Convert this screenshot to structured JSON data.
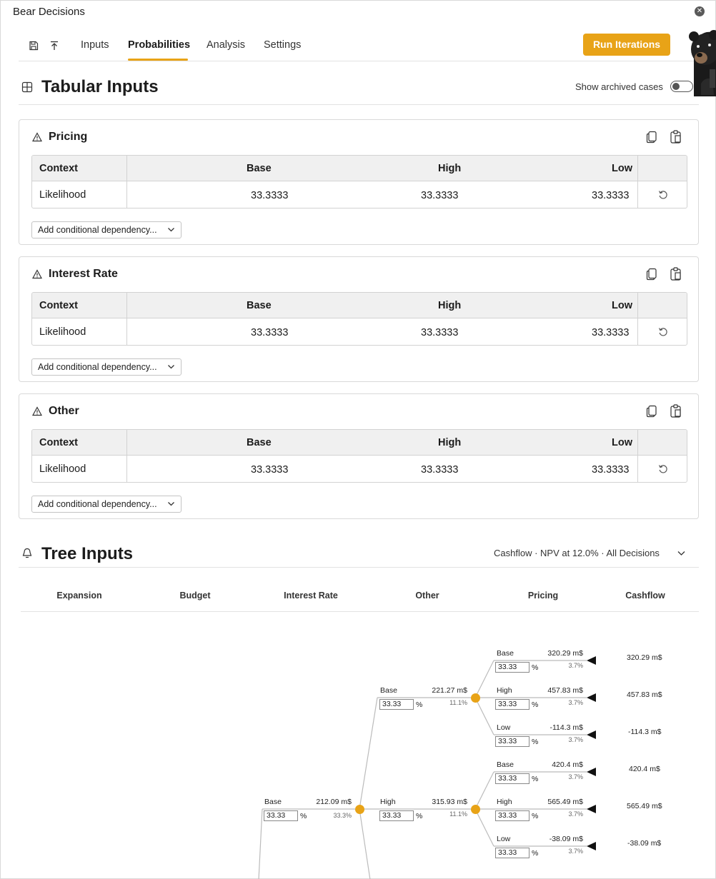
{
  "app": {
    "title": "Bear Decisions"
  },
  "nav": {
    "tabs": [
      "Inputs",
      "Probabilities",
      "Analysis",
      "Settings"
    ],
    "active_tab": "Probabilities",
    "run_label": "Run Iterations"
  },
  "tabular": {
    "title": "Tabular Inputs",
    "toggle_label": "Show archived cases",
    "toggle_on": false
  },
  "tables": [
    {
      "title": "Pricing",
      "columns": [
        "Context",
        "Base",
        "High",
        "Low"
      ],
      "row_label": "Likelihood",
      "values": [
        "33.3333",
        "33.3333",
        "33.3333"
      ],
      "dep_label": "Add conditional dependency..."
    },
    {
      "title": "Interest Rate",
      "columns": [
        "Context",
        "Base",
        "High",
        "Low"
      ],
      "row_label": "Likelihood",
      "values": [
        "33.3333",
        "33.3333",
        "33.3333"
      ],
      "dep_label": "Add conditional dependency..."
    },
    {
      "title": "Other",
      "columns": [
        "Context",
        "Base",
        "High",
        "Low"
      ],
      "row_label": "Likelihood",
      "values": [
        "33.3333",
        "33.3333",
        "33.3333"
      ],
      "dep_label": "Add conditional dependency..."
    }
  ],
  "tree": {
    "title": "Tree Inputs",
    "selector": "Cashflow · NPV at 12.0% · All Decisions",
    "columns": [
      "Expansion",
      "Budget",
      "Interest Rate",
      "Other",
      "Pricing",
      "Cashflow"
    ],
    "pct_symbol": "%",
    "interest_branches": [
      {
        "label": "Base",
        "value": "212.09 m$",
        "prob": "33.3%",
        "input": "33.33"
      }
    ],
    "other_branches": [
      {
        "label": "Base",
        "value": "221.27 m$",
        "prob": "11.1%",
        "input": "33.33"
      },
      {
        "label": "High",
        "value": "315.93 m$",
        "prob": "11.1%",
        "input": "33.33"
      }
    ],
    "pricing_branches": [
      {
        "label": "Base",
        "value": "320.29 m$",
        "prob": "3.7%",
        "input": "33.33",
        "end": "320.29 m$"
      },
      {
        "label": "High",
        "value": "457.83 m$",
        "prob": "3.7%",
        "input": "33.33",
        "end": "457.83 m$"
      },
      {
        "label": "Low",
        "value": "-114.3 m$",
        "prob": "3.7%",
        "input": "33.33",
        "end": "-114.3 m$"
      },
      {
        "label": "Base",
        "value": "420.4 m$",
        "prob": "3.7%",
        "input": "33.33",
        "end": "420.4 m$"
      },
      {
        "label": "High",
        "value": "565.49 m$",
        "prob": "3.7%",
        "input": "33.33",
        "end": "565.49 m$"
      },
      {
        "label": "Low",
        "value": "-38.09 m$",
        "prob": "3.7%",
        "input": "33.33",
        "end": "-38.09 m$"
      }
    ]
  },
  "colors": {
    "accent": "#e8a317",
    "border": "#d9d9d9",
    "header_bg": "#f0f0f0"
  },
  "icons": [
    "save-icon",
    "export-icon",
    "close-icon",
    "table-grid-icon",
    "warning-icon",
    "copy-icon",
    "paste-icon",
    "reset-icon",
    "chevron-down-icon",
    "tree-icon",
    "bear-logo"
  ]
}
